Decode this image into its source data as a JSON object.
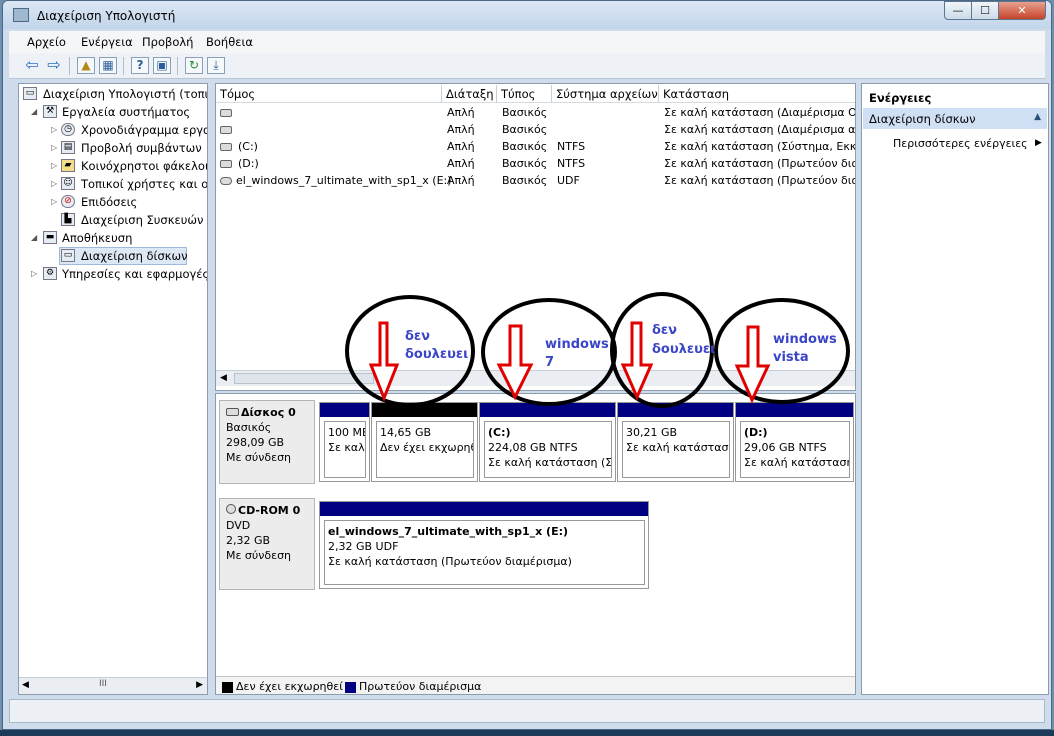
{
  "window": {
    "title": "Διαχείριση Υπολογιστή",
    "min_glyph": "—",
    "max_glyph": "☐",
    "close_glyph": "✕"
  },
  "menu": [
    "Αρχείο",
    "Ενέργεια",
    "Προβολή",
    "Βοήθεια"
  ],
  "toolbar": {
    "icons": [
      "back-arrow-icon",
      "forward-arrow-icon",
      "up-folder-icon",
      "show-hide-tree-icon",
      "help-icon",
      "console-icon",
      "refresh-icon",
      "export-icon"
    ],
    "glyphs": [
      "⇦",
      "⇨",
      "▲",
      "▦",
      "?",
      "▣",
      "↻",
      "⤓"
    ]
  },
  "tree": [
    {
      "label": "Διαχείριση Υπολογιστή (τοπικ",
      "level": 0,
      "expander": ""
    },
    {
      "label": "Εργαλεία συστήματος",
      "level": 1,
      "expander": "◢"
    },
    {
      "label": "Χρονοδιάγραμμα εργασ",
      "level": 2,
      "expander": "▷"
    },
    {
      "label": "Προβολή συμβάντων",
      "level": 2,
      "expander": "▷"
    },
    {
      "label": "Κοινόχρηστοι φάκελοι",
      "level": 2,
      "expander": "▷"
    },
    {
      "label": "Τοπικοί χρήστες και ομ",
      "level": 2,
      "expander": "▷"
    },
    {
      "label": "Επιδόσεις",
      "level": 2,
      "expander": "▷"
    },
    {
      "label": "Διαχείριση Συσκευών",
      "level": 2,
      "expander": ""
    },
    {
      "label": "Αποθήκευση",
      "level": 1,
      "expander": "◢"
    },
    {
      "label": "Διαχείριση δίσκων",
      "level": 2,
      "expander": ""
    },
    {
      "label": "Υπηρεσίες και εφαρμογές",
      "level": 1,
      "expander": "▷"
    }
  ],
  "tree_scroll": {
    "thumb": "III"
  },
  "columns": [
    "Τόμος",
    "Διάταξη",
    "Τύπος",
    "Σύστημα αρχείων",
    "Κατάσταση"
  ],
  "volumes": [
    {
      "name": "",
      "layout": "Απλή",
      "type": "Βασικός",
      "fs": "",
      "status": "Σε καλή κατάσταση (Διαμέρισμα OEM"
    },
    {
      "name": "",
      "layout": "Απλή",
      "type": "Βασικός",
      "fs": "",
      "status": "Σε καλή κατάσταση (Διαμέρισμα απο"
    },
    {
      "name": "(C:)",
      "layout": "Απλή",
      "type": "Βασικός",
      "fs": "NTFS",
      "status": "Σε καλή κατάσταση (Σύστημα, Εκκίνη"
    },
    {
      "name": "(D:)",
      "layout": "Απλή",
      "type": "Βασικός",
      "fs": "NTFS",
      "status": "Σε καλή κατάσταση (Πρωτεύον διαμ"
    },
    {
      "name": "el_windows_7_ultimate_with_sp1_x (E:)",
      "layout": "Απλή",
      "type": "Βασικός",
      "fs": "UDF",
      "status": "Σε καλή κατάσταση (Πρωτεύον διαμ"
    }
  ],
  "disks": [
    {
      "name": "Δίσκος 0",
      "lines": [
        "Βασικός",
        "298,09 GB",
        "Με σύνδεση"
      ],
      "partitions": [
        {
          "title": "",
          "size": "100 ME",
          "status": "Σε καλή",
          "unallocated": false
        },
        {
          "title": "",
          "size": "14,65 GB",
          "status": "Δεν έχει εκχωρηθ",
          "unallocated": true
        },
        {
          "title": "(C:)",
          "size": "224,08 GB NTFS",
          "status": "Σε καλή κατάσταση (Σύ",
          "unallocated": false
        },
        {
          "title": "",
          "size": "30,21 GB",
          "status": "Σε καλή κατάστασ",
          "unallocated": false
        },
        {
          "title": "(D:)",
          "size": "29,06 GB NTFS",
          "status": "Σε καλή κατάσταση",
          "unallocated": false
        }
      ]
    },
    {
      "name": "CD-ROM 0",
      "lines": [
        "DVD",
        "2,32 GB",
        "Με σύνδεση"
      ],
      "partitions": [
        {
          "title": "el_windows_7_ultimate_with_sp1_x  (E:)",
          "size": "2,32 GB UDF",
          "status": "Σε καλή κατάσταση (Πρωτεύον διαμέρισμα)",
          "unallocated": false
        }
      ]
    }
  ],
  "legend": [
    {
      "label": "Δεν έχει εκχωρηθεί",
      "color": "#000000"
    },
    {
      "label": "Πρωτεύον διαμέρισμα",
      "color": "#000080"
    }
  ],
  "actions": {
    "title": "Ενέργειες",
    "section": "Διαχείριση δίσκων",
    "more": "Περισσότερες ενέργειες"
  },
  "annotations": [
    {
      "text": "δεν δουλευει"
    },
    {
      "text": "windows 7"
    },
    {
      "text": "δεν δουλευει"
    },
    {
      "text": "windows vista"
    }
  ]
}
